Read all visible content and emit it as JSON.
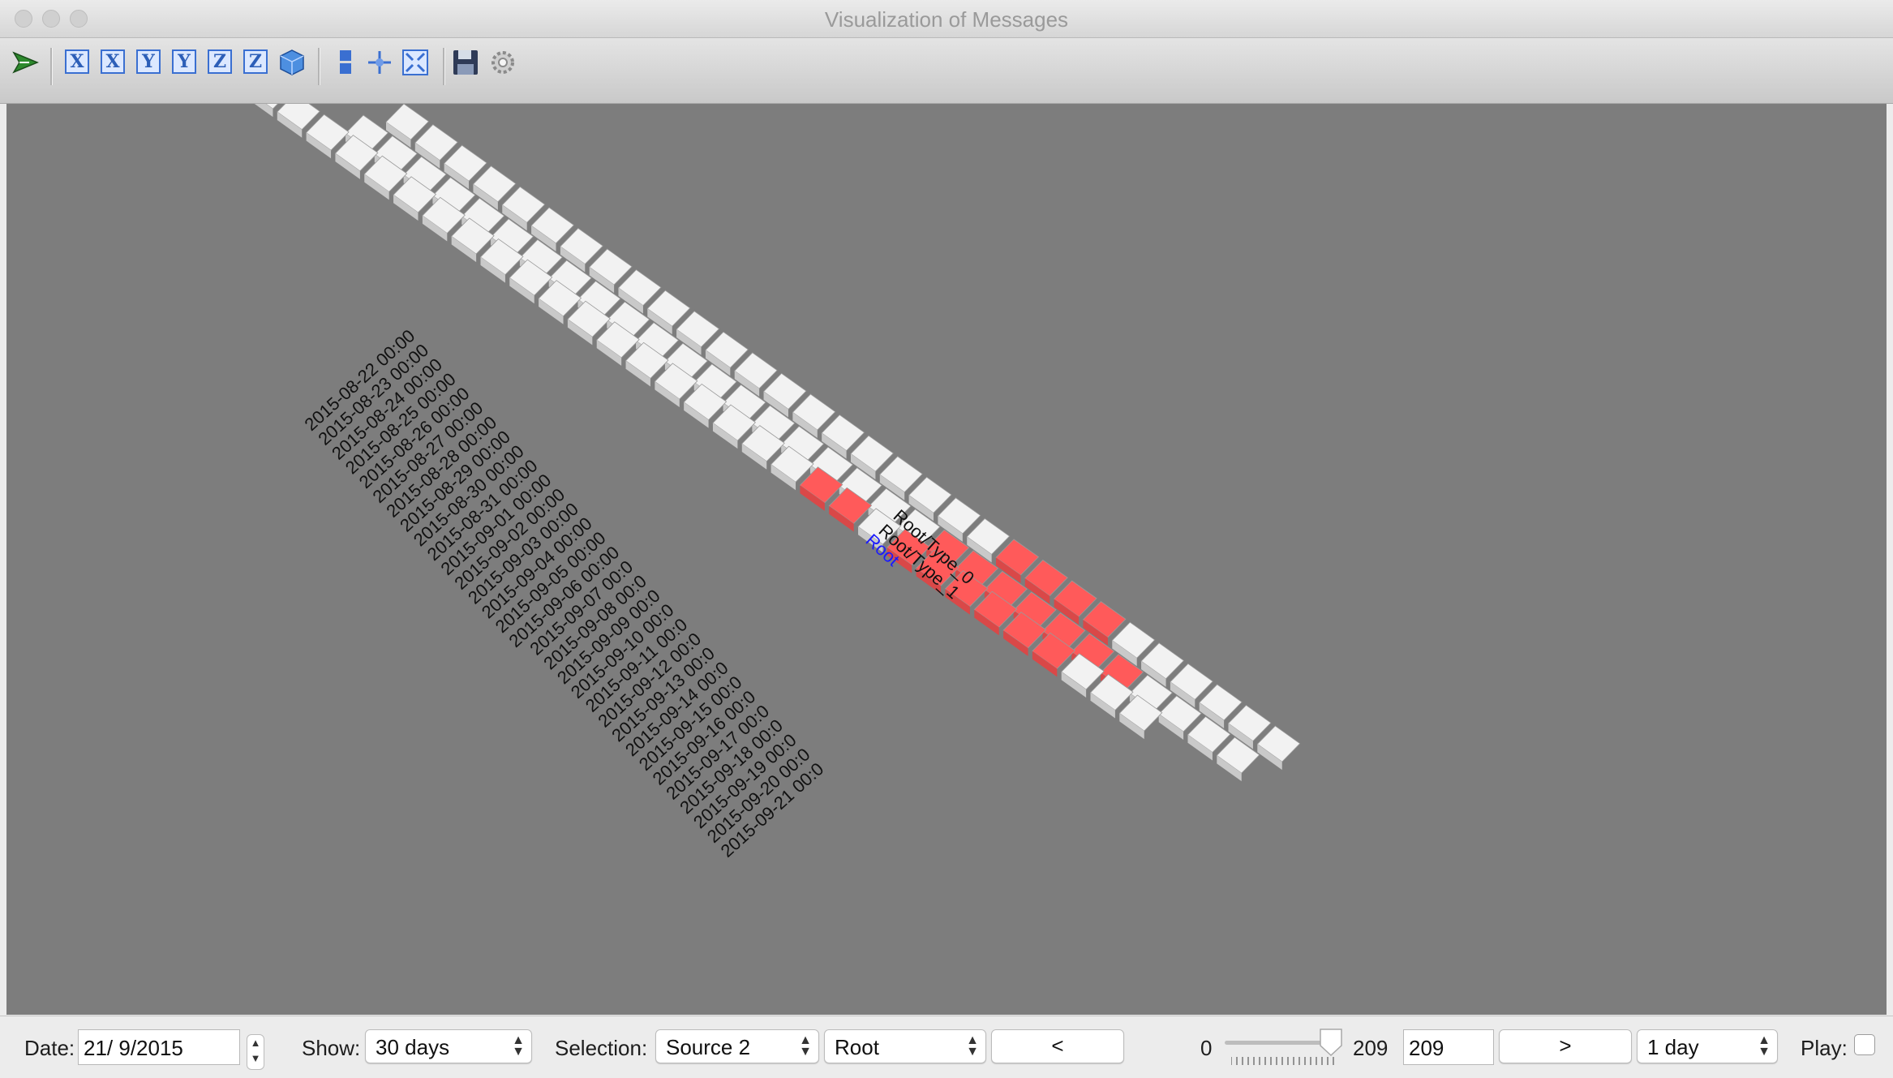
{
  "window": {
    "title": "Visualization of Messages"
  },
  "toolbar": {
    "icons": [
      "pointer-arrow-icon",
      "x-axis-icon",
      "x-axis-reverse-icon",
      "y-axis-icon",
      "y-axis-reverse-icon",
      "z-axis-icon",
      "z-axis-reverse-icon",
      "cube-view-icon",
      "layout-icon",
      "center-icon",
      "fit-view-icon",
      "save-icon",
      "settings-icon"
    ],
    "axis_x": "X",
    "axis_y": "Y",
    "axis_z": "Z"
  },
  "viz": {
    "date_labels": [
      "2015-08-22 00:00",
      "2015-08-23 00:00",
      "2015-08-24 00:00",
      "2015-08-25 00:00",
      "2015-08-26 00:00",
      "2015-08-27 00:00",
      "2015-08-28 00:00",
      "2015-08-29 00:00",
      "2015-08-30 00:00",
      "2015-08-31 00:00",
      "2015-09-01 00:00",
      "2015-09-02 00:00",
      "2015-09-03 00:00",
      "2015-09-04 00:00",
      "2015-09-05 00:00",
      "2015-09-06 00:00",
      "2015-09-07 00:0",
      "2015-09-08 00:0",
      "2015-09-09 00:0",
      "2015-09-10 00:0",
      "2015-09-11 00:0",
      "2015-09-12 00:0",
      "2015-09-13 00:0",
      "2015-09-14 00:0",
      "2015-09-15 00:0",
      "2015-09-16 00:0",
      "2015-09-17 00:0",
      "2015-09-18 00:0",
      "2015-09-19 00:0",
      "2015-09-20 00:0",
      "2015-09-21 00:0"
    ],
    "row_labels": [
      "Root/Type_0",
      "Root/Type_1",
      "Root"
    ],
    "root_color": "#1a1aff",
    "highlight_color": "#ff5a5a",
    "bar_color": "#f2f2f2"
  },
  "controls": {
    "date_label": "Date:",
    "date_value": "21/  9/2015",
    "show_label": "Show:",
    "show_value": "30 days",
    "selection_label": "Selection:",
    "selection_source": "Source 2",
    "selection_node": "Root",
    "prev_button": "<",
    "slider_min": "0",
    "slider_max": "209",
    "slider_value": "209",
    "next_button": ">",
    "step_value": "1 day",
    "play_label": "Play:"
  }
}
